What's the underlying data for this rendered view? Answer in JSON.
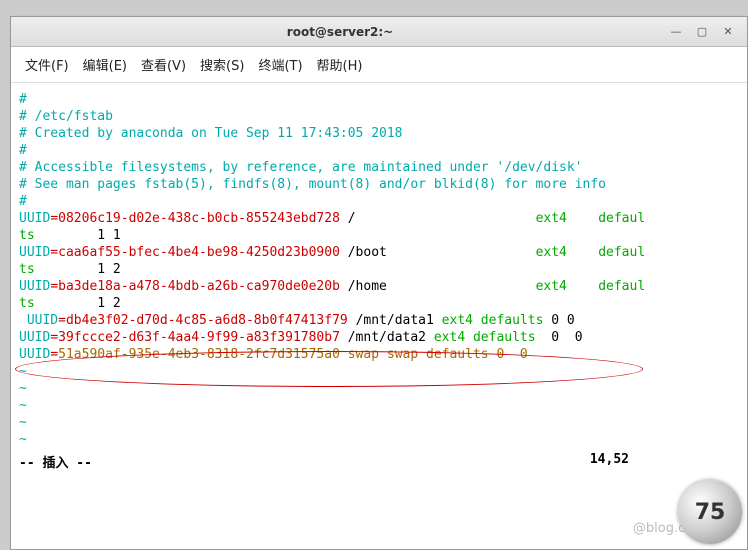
{
  "window": {
    "title": "root@server2:~"
  },
  "menu": {
    "file": "文件(F)",
    "edit": "编辑(E)",
    "view": "查看(V)",
    "search": "搜索(S)",
    "terminal": "终端(T)",
    "help": "帮助(H)"
  },
  "fstab": {
    "c1": "#",
    "c2": "# /etc/fstab",
    "c3": "# Created by anaconda on Tue Sep 11 17:43:05 2018",
    "c4": "#",
    "c5": "# Accessible filesystems, by reference, are maintained under '/dev/disk'",
    "c6": "# See man pages fstab(5), findfs(8), mount(8) and/or blkid(8) for more info",
    "c7": "#"
  },
  "rows": [
    {
      "uuid": "08206c19-d02e-438c-b0cb-855243ebd728",
      "mp": "/",
      "fs": "ext4",
      "opt": "defaul",
      "wrap": "ts",
      "dp": "1 1"
    },
    {
      "uuid": "caa6af55-bfec-4be4-be98-4250d23b0900",
      "mp": "/boot",
      "fs": "ext4",
      "opt": "defaul",
      "wrap": "ts",
      "dp": "1 2"
    },
    {
      "uuid": "ba3de18a-a478-4bdb-a26b-ca970de0e20b",
      "mp": "/home",
      "fs": "ext4",
      "opt": "defaul",
      "wrap": "ts",
      "dp": "1 2"
    },
    {
      "uuid": "db4e3f02-d70d-4c85-a6d8-8b0f47413f79",
      "mp": "/mnt/data1",
      "fs": "ext4",
      "opt": "defaults",
      "dp": "0 0",
      "sp": true
    },
    {
      "uuid": "39fccce2-d63f-4aa4-9f99-a83f391780b7",
      "mp": "/mnt/data2",
      "fs": "ext4",
      "opt": "defaults",
      "dp": " 0  0"
    },
    {
      "uuid": "51a590af-935e-4eb3-8318-2fc7d31575a0",
      "mp": "swap",
      "fs": "swap",
      "opt": "defaults",
      "dp": "0  0",
      "swap": true
    }
  ],
  "uuid_label": "UUID",
  "status": {
    "mode": "-- 插入 --",
    "pos": "14,52"
  },
  "circle": "75",
  "watermark": "@blog.csdn.net"
}
